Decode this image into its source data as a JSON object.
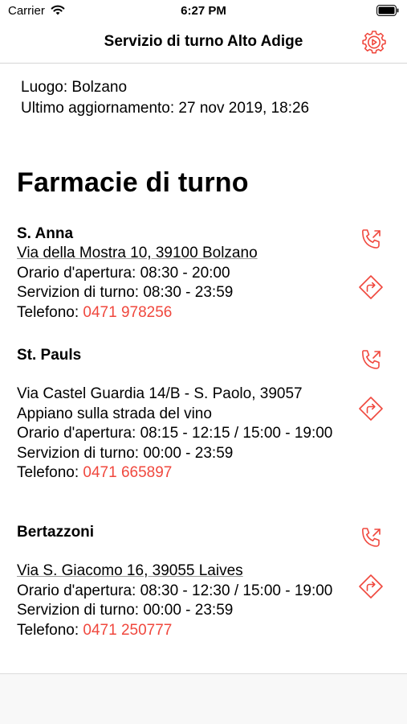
{
  "status_bar": {
    "carrier": "Carrier",
    "time": "6:27 PM"
  },
  "nav": {
    "title": "Servizio di turno Alto Adige",
    "settings_icon": "settings-gear-icon"
  },
  "info": {
    "location": "Luogo: Bolzano",
    "last_update": "Ultimo aggiornamento: 27 nov 2019, 18:26"
  },
  "section_title": "Farmacie di turno",
  "accent_color": "#f0483e",
  "labels": {
    "phone_prefix": "Telefono: "
  },
  "pharmacies": [
    {
      "name": "S. Anna",
      "address": "Via della Mostra 10, 39100 Bolzano",
      "opening": "Orario d'apertura: 08:30 - 20:00",
      "duty": "Servizion di turno: 08:30 - 23:59",
      "phone": "0471 978256"
    },
    {
      "name": "St. Pauls",
      "address_line1": "Via Castel Guardia 14/B - S. Paolo, 39057",
      "address_line2": "Appiano sulla strada del vino",
      "opening": "Orario d'apertura: 08:15 - 12:15 / 15:00 - 19:00",
      "duty": "Servizion di turno: 00:00 - 23:59",
      "phone": "0471 665897"
    },
    {
      "name": "Bertazzoni",
      "address": "Via S. Giacomo 16, 39055 Laives",
      "opening": "Orario d'apertura: 08:30 - 12:30 / 15:00 - 19:00",
      "duty": "Servizion di turno: 00:00 - 23:59",
      "phone": "0471 250777"
    }
  ]
}
